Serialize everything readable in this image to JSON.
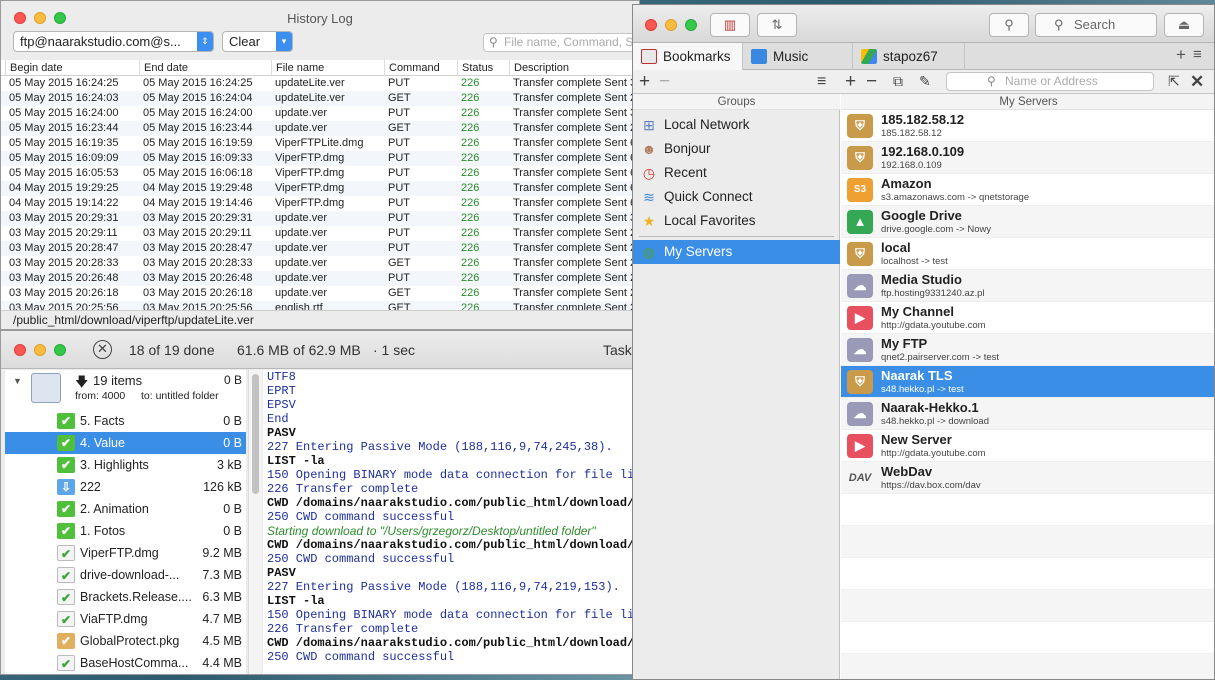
{
  "history": {
    "title": "History Log",
    "account": "ftp@naarakstudio.com@s...",
    "clear_label": "Clear",
    "search_placeholder": "File name, Command, S...",
    "columns": [
      "Begin date",
      "End date",
      "File name",
      "Command",
      "Status",
      "Description"
    ],
    "rows": [
      [
        "05 May 2015 16:24:25",
        "05 May 2015 16:24:25",
        "updateLite.ver",
        "PUT",
        "226",
        "Transfer complete Sent 3"
      ],
      [
        "05 May 2015 16:24:03",
        "05 May 2015 16:24:04",
        "updateLite.ver",
        "GET",
        "226",
        "Transfer complete Sent 2"
      ],
      [
        "05 May 2015 16:24:00",
        "05 May 2015 16:24:00",
        "update.ver",
        "PUT",
        "226",
        "Transfer complete Sent 3"
      ],
      [
        "05 May 2015 16:23:44",
        "05 May 2015 16:23:44",
        "update.ver",
        "GET",
        "226",
        "Transfer complete Sent 2"
      ],
      [
        "05 May 2015 16:19:35",
        "05 May 2015 16:19:59",
        "ViperFTPLite.dmg",
        "PUT",
        "226",
        "Transfer complete Sent 62"
      ],
      [
        "05 May 2015 16:09:09",
        "05 May 2015 16:09:33",
        "ViperFTP.dmg",
        "PUT",
        "226",
        "Transfer complete Sent 64"
      ],
      [
        "05 May 2015 16:05:53",
        "05 May 2015 16:06:18",
        "ViperFTP.dmg",
        "PUT",
        "226",
        "Transfer complete Sent 64"
      ],
      [
        "04 May 2015 19:29:25",
        "04 May 2015 19:29:48",
        "ViperFTP.dmg",
        "PUT",
        "226",
        "Transfer complete Sent 60"
      ],
      [
        "04 May 2015 19:14:22",
        "04 May 2015 19:14:46",
        "ViperFTP.dmg",
        "PUT",
        "226",
        "Transfer complete Sent 62"
      ],
      [
        "03 May 2015 20:29:31",
        "03 May 2015 20:29:31",
        "update.ver",
        "PUT",
        "226",
        "Transfer complete Sent 3"
      ],
      [
        "03 May 2015 20:29:11",
        "03 May 2015 20:29:11",
        "update.ver",
        "PUT",
        "226",
        "Transfer complete Sent 2"
      ],
      [
        "03 May 2015 20:28:47",
        "03 May 2015 20:28:47",
        "update.ver",
        "PUT",
        "226",
        "Transfer complete Sent 2"
      ],
      [
        "03 May 2015 20:28:33",
        "03 May 2015 20:28:33",
        "update.ver",
        "GET",
        "226",
        "Transfer complete Sent 2"
      ],
      [
        "03 May 2015 20:26:48",
        "03 May 2015 20:26:48",
        "update.ver",
        "PUT",
        "226",
        "Transfer complete Sent 2"
      ],
      [
        "03 May 2015 20:26:18",
        "03 May 2015 20:26:18",
        "update.ver",
        "GET",
        "226",
        "Transfer complete Sent 2"
      ],
      [
        "03 May 2015 20:25:56",
        "03 May 2015 20:25:56",
        "english.rtf",
        "GET",
        "226",
        "Transfer complete Sent 2"
      ]
    ],
    "path": "/public_html/download/viperftp/updateLite.ver"
  },
  "tasks": {
    "summary": "18 of 19 done",
    "bytes": "61.6 MB of 62.9 MB",
    "time": "· 1 sec",
    "title_partial": "Task",
    "group_title": "19 items",
    "group_size": "0 B",
    "group_from": "from: 4000",
    "group_to": "to: untitled folder",
    "items": [
      {
        "name": "5. Facts",
        "size": "0 B",
        "icon": "folder-check-icon"
      },
      {
        "name": "4. Value",
        "size": "0 B",
        "icon": "folder-check-icon",
        "selected": true
      },
      {
        "name": "3. Highlights",
        "size": "3 kB",
        "icon": "folder-check-icon"
      },
      {
        "name": "222",
        "size": "126 kB",
        "icon": "folder-download-icon"
      },
      {
        "name": "2. Animation",
        "size": "0 B",
        "icon": "folder-check-icon"
      },
      {
        "name": "1. Fotos",
        "size": "0 B",
        "icon": "folder-check-icon"
      },
      {
        "name": "ViperFTP.dmg",
        "size": "9.2 MB",
        "icon": "file-check-icon"
      },
      {
        "name": "drive-download-...",
        "size": "7.3 MB",
        "icon": "file-check-icon"
      },
      {
        "name": "Brackets.Release....",
        "size": "6.3 MB",
        "icon": "file-check-icon"
      },
      {
        "name": "ViaFTP.dmg",
        "size": "4.7 MB",
        "icon": "file-check-icon"
      },
      {
        "name": "GlobalProtect.pkg",
        "size": "4.5 MB",
        "icon": "package-check-icon"
      },
      {
        "name": "BaseHostComma...",
        "size": "4.4 MB",
        "icon": "file-check-icon"
      }
    ],
    "log": [
      {
        "t": "UTF8",
        "c": "lb"
      },
      {
        "t": "EPRT",
        "c": "lb"
      },
      {
        "t": "EPSV",
        "c": "lb"
      },
      {
        "t": "End",
        "c": "lb"
      },
      {
        "t": "PASV",
        "c": "lk"
      },
      {
        "t": "227 Entering Passive Mode (188,116,9,74,245,38).",
        "c": "lb"
      },
      {
        "t": "LIST -la",
        "c": "lk"
      },
      {
        "t": "150 Opening BINARY mode data connection for file li",
        "c": "lb"
      },
      {
        "t": "226 Transfer complete",
        "c": "lb"
      },
      {
        "t": "CWD /domains/naarakstudio.com/public_html/download/",
        "c": "lk"
      },
      {
        "t": "250 CWD command successful",
        "c": "lb"
      },
      {
        "t": "Starting download to \"/Users/grzegorz/Desktop/untitled folder\"",
        "c": "lg"
      },
      {
        "t": "CWD /domains/naarakstudio.com/public_html/download/",
        "c": "lk"
      },
      {
        "t": "250 CWD command successful",
        "c": "lb"
      },
      {
        "t": "PASV",
        "c": "lk"
      },
      {
        "t": "227 Entering Passive Mode (188,116,9,74,219,153).",
        "c": "lb"
      },
      {
        "t": "LIST -la",
        "c": "lk"
      },
      {
        "t": "150 Opening BINARY mode data connection for file li",
        "c": "lb"
      },
      {
        "t": "226 Transfer complete",
        "c": "lb"
      },
      {
        "t": "CWD /domains/naarakstudio.com/public_html/download/",
        "c": "lk"
      },
      {
        "t": "250 CWD command successful",
        "c": "lb"
      }
    ]
  },
  "servers": {
    "search_label": "Search",
    "tabs": [
      "Bookmarks",
      "Music",
      "stapoz67"
    ],
    "filter_placeholder": "Name or Address",
    "groups_header": "Groups",
    "servers_header": "My Servers",
    "groups": [
      {
        "label": "Local Network",
        "icon": "network-icon"
      },
      {
        "label": "Bonjour",
        "icon": "bonjour-icon"
      },
      {
        "label": "Recent",
        "icon": "clock-icon"
      },
      {
        "label": "Quick Connect",
        "icon": "wifi-icon"
      },
      {
        "label": "Local Favorites",
        "icon": "star-icon"
      },
      {
        "label": "My Servers",
        "icon": "globe-icon",
        "active": true
      }
    ],
    "list": [
      {
        "name": "185.182.58.12",
        "detail": "185.182.58.12",
        "icon": "shield-icon",
        "color": "#c99a4a"
      },
      {
        "name": "192.168.0.109",
        "detail": "192.168.0.109",
        "icon": "shield-icon",
        "color": "#c99a4a"
      },
      {
        "name": "Amazon",
        "detail": "s3.amazonaws.com -> qnetstorage",
        "icon": "amazon-s3-icon",
        "color": "#f0a030"
      },
      {
        "name": "Google Drive",
        "detail": "drive.google.com -> Nowy",
        "icon": "google-drive-icon",
        "color": "#34a853"
      },
      {
        "name": "local",
        "detail": "localhost -> test",
        "icon": "shield-icon",
        "color": "#c99a4a"
      },
      {
        "name": "Media Studio",
        "detail": "ftp.hosting9331240.az.pl",
        "icon": "cloud-icon",
        "color": "#9a9ab8"
      },
      {
        "name": "My Channel",
        "detail": "http://gdata.youtube.com",
        "icon": "youtube-icon",
        "color": "#e85060"
      },
      {
        "name": "My FTP",
        "detail": "qnet2.pairserver.com -> test",
        "icon": "cloud-icon",
        "color": "#9a9ab8"
      },
      {
        "name": "Naarak TLS",
        "detail": "s48.hekko.pl -> test",
        "icon": "shield-icon",
        "color": "#c99a4a",
        "active": true
      },
      {
        "name": "Naarak-Hekko.1",
        "detail": "s48.hekko.pl -> download",
        "icon": "cloud-icon",
        "color": "#9a9ab8"
      },
      {
        "name": "New Server",
        "detail": "http://gdata.youtube.com",
        "icon": "youtube-icon",
        "color": "#e85060"
      },
      {
        "name": "WebDav",
        "detail": "https://dav.box.com/dav",
        "icon": "dav-icon",
        "color": "#555555"
      }
    ]
  }
}
